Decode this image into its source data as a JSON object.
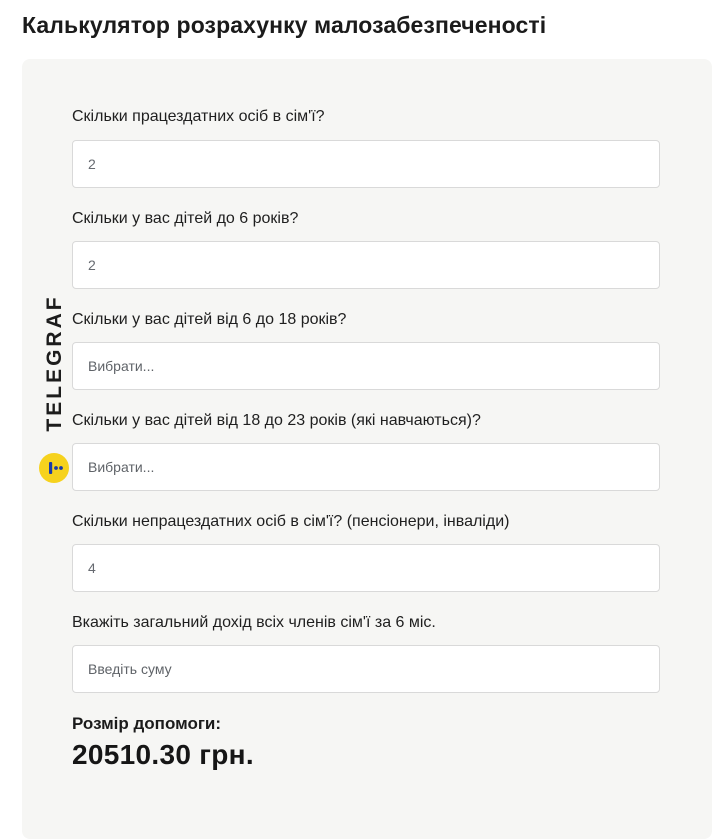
{
  "page": {
    "title": "Калькулятор розрахунку малозабезпеченості"
  },
  "questions": [
    {
      "label": "Скільки працездатних осіб в сім'ї?",
      "value": "2"
    },
    {
      "label": "Скільки у вас дітей до 6 років?",
      "value": "2"
    },
    {
      "label": "Скільки у вас дітей від 6 до 18 років?",
      "placeholder": "Вибрати..."
    },
    {
      "label": "Скільки у вас дітей від 18 до 23 років (які навчаються)?",
      "placeholder": "Вибрати..."
    },
    {
      "label": "Скільки непрацездатних осіб в сім'ї? (пенсіонери, інваліди)",
      "value": "4"
    },
    {
      "label": "Вкажіть загальний дохід всіх членів сім'ї за 6 міс.",
      "placeholder": "Введіть суму"
    }
  ],
  "result": {
    "label": "Розмір допомоги:",
    "value": "20510.30 грн."
  },
  "watermark": {
    "text": "TELEGRAF",
    "logo_color": "#f6d21d"
  }
}
